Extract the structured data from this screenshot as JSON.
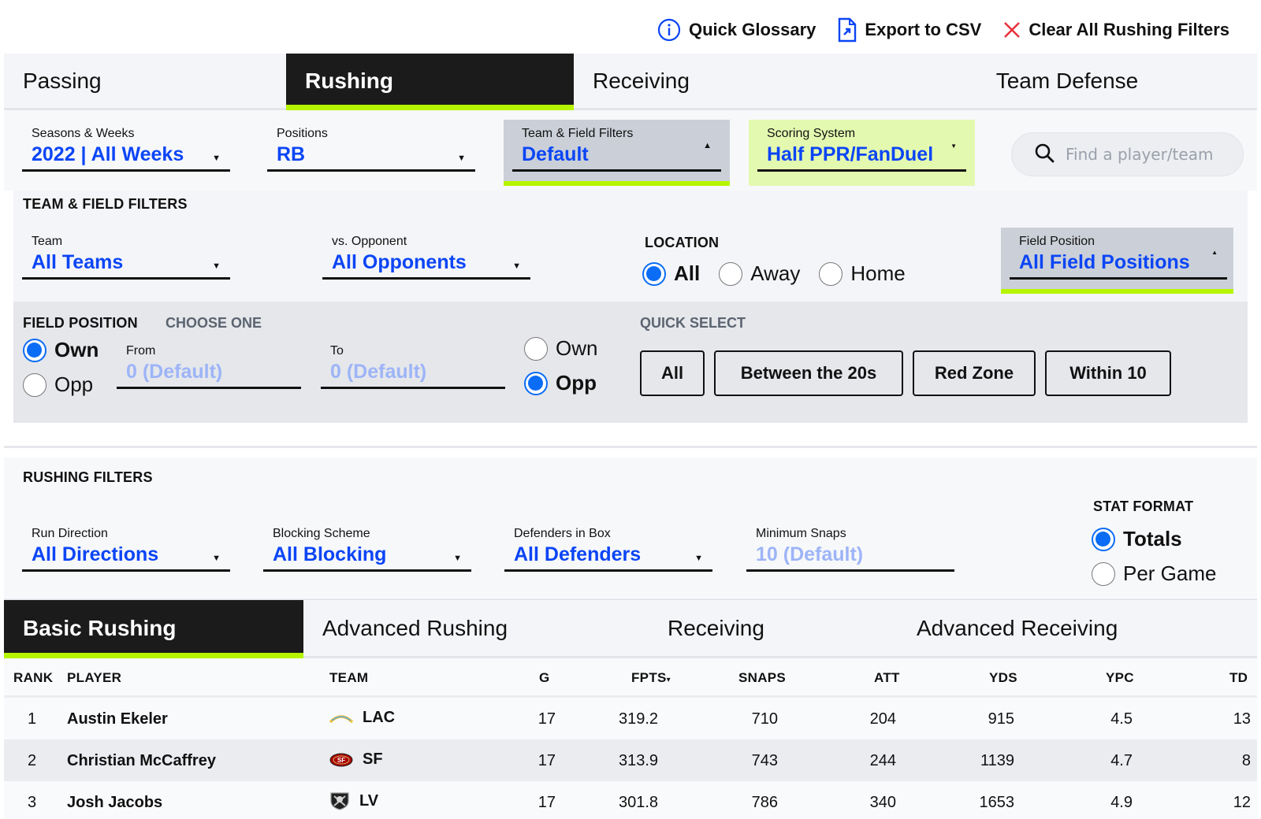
{
  "top_actions": {
    "glossary": "Quick Glossary",
    "export": "Export to CSV",
    "clear": "Clear All Rushing Filters"
  },
  "main_tabs": [
    {
      "label": "Passing",
      "active": false
    },
    {
      "label": "Rushing",
      "active": true
    },
    {
      "label": "Receiving",
      "active": false
    },
    {
      "label": "Team Defense",
      "active": false
    }
  ],
  "filters": {
    "seasons": {
      "label": "Seasons & Weeks",
      "value": "2022 | All Weeks"
    },
    "positions": {
      "label": "Positions",
      "value": "RB"
    },
    "team_field": {
      "label": "Team & Field Filters",
      "value": "Default"
    },
    "scoring": {
      "label": "Scoring System",
      "value": "Half PPR/FanDuel"
    },
    "search_placeholder": "Find a player/team"
  },
  "team_field_panel": {
    "title": "TEAM & FIELD FILTERS",
    "team": {
      "label": "Team",
      "value": "All Teams"
    },
    "opponent": {
      "label": "vs. Opponent",
      "value": "All Opponents"
    },
    "location": {
      "title": "LOCATION",
      "options": [
        "All",
        "Away",
        "Home"
      ],
      "selected": "All"
    },
    "field_position": {
      "label": "Field Position",
      "value": "All Field Positions"
    }
  },
  "field_position_panel": {
    "title": "FIELD POSITION",
    "subtitle": "CHOOSE ONE",
    "from_side": {
      "options": [
        "Own",
        "Opp"
      ],
      "selected": "Own"
    },
    "from": {
      "label": "From",
      "placeholder": "0 (Default)"
    },
    "to": {
      "label": "To",
      "placeholder": "0 (Default)"
    },
    "to_side": {
      "options": [
        "Own",
        "Opp"
      ],
      "selected": "Opp"
    },
    "quick_select": {
      "title": "QUICK SELECT",
      "buttons": [
        "All",
        "Between the 20s",
        "Red Zone",
        "Within 10"
      ]
    }
  },
  "rushing_filters": {
    "title": "RUSHING FILTERS",
    "run_direction": {
      "label": "Run Direction",
      "value": "All Directions"
    },
    "blocking": {
      "label": "Blocking Scheme",
      "value": "All Blocking"
    },
    "defenders": {
      "label": "Defenders in Box",
      "value": "All Defenders"
    },
    "min_snaps": {
      "label": "Minimum Snaps",
      "placeholder": "10 (Default)"
    },
    "stat_format": {
      "title": "STAT FORMAT",
      "options": [
        "Totals",
        "Per Game"
      ],
      "selected": "Totals"
    }
  },
  "sub_tabs": [
    {
      "label": "Basic Rushing",
      "active": true
    },
    {
      "label": "Advanced Rushing",
      "active": false
    },
    {
      "label": "Receiving",
      "active": false
    },
    {
      "label": "Advanced Receiving",
      "active": false
    }
  ],
  "table": {
    "columns": [
      "RANK",
      "PLAYER",
      "TEAM",
      "G",
      "FPTS",
      "SNAPS",
      "ATT",
      "YDS",
      "YPC",
      "TD"
    ],
    "sort_indicator": "▾",
    "rows": [
      {
        "rank": "1",
        "player": "Austin Ekeler",
        "team": "LAC",
        "logo": "chargers-logo-icon",
        "g": "17",
        "fpts": "319.2",
        "snaps": "710",
        "att": "204",
        "yds": "915",
        "ypc": "4.5",
        "td": "13"
      },
      {
        "rank": "2",
        "player": "Christian McCaffrey",
        "team": "SF",
        "logo": "49ers-logo-icon",
        "g": "17",
        "fpts": "313.9",
        "snaps": "743",
        "att": "244",
        "yds": "1139",
        "ypc": "4.7",
        "td": "8"
      },
      {
        "rank": "3",
        "player": "Josh Jacobs",
        "team": "LV",
        "logo": "raiders-logo-icon",
        "g": "17",
        "fpts": "301.8",
        "snaps": "786",
        "att": "340",
        "yds": "1653",
        "ypc": "4.9",
        "td": "12"
      }
    ]
  },
  "colors": {
    "accent_blue": "#0b45f5",
    "radio_blue": "#0b6cf5",
    "lime": "#b5f500",
    "dark": "#1b1b1b"
  }
}
